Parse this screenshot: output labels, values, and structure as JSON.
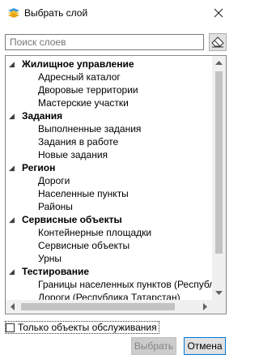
{
  "window": {
    "title": "Выбрать слой",
    "icon": "layers-icon",
    "close_icon": "close-icon"
  },
  "search": {
    "placeholder": "Поиск слоев",
    "clear_icon": "eraser-icon"
  },
  "tree": {
    "groups": [
      {
        "label": "Жилищное управление",
        "items": [
          "Адресный каталог",
          "Дворовые территории",
          "Мастерские участки"
        ]
      },
      {
        "label": "Задания",
        "items": [
          "Выполненные задания",
          "Задания в работе",
          "Новые задания"
        ]
      },
      {
        "label": "Регион",
        "items": [
          "Дороги",
          "Населенные пункты",
          "Районы"
        ]
      },
      {
        "label": "Сервисные объекты",
        "items": [
          "Контейнерные площадки",
          "Сервисные объекты",
          "Урны"
        ]
      },
      {
        "label": "Тестирование",
        "items": [
          "Границы населенных пунктов (Республ",
          "Дороги (Республика Татарстан)"
        ]
      }
    ]
  },
  "options": {
    "only_service_label": "Только объекты обслуживания",
    "only_service_checked": false
  },
  "buttons": {
    "select_label": "Выбрать",
    "select_enabled": false,
    "cancel_label": "Отмена"
  }
}
